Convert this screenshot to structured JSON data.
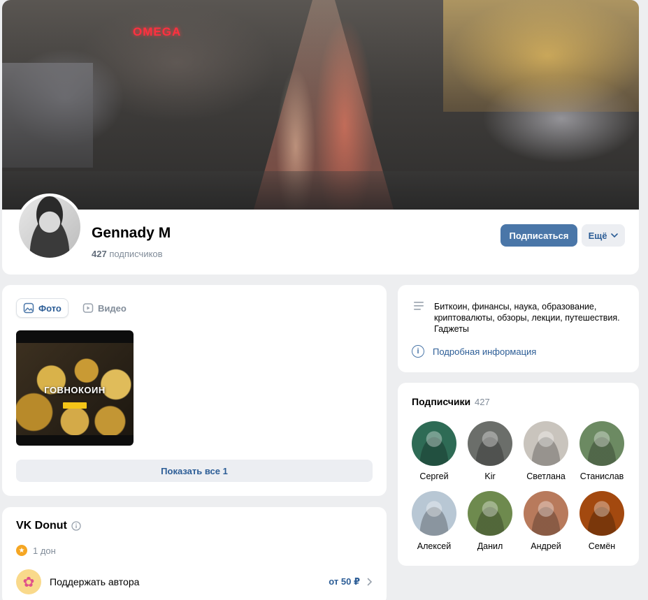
{
  "cover": {
    "sign_text": "OMEGA"
  },
  "profile": {
    "name": "Gennady M",
    "subscribers_count": "427",
    "subscribers_label": "подписчиков",
    "subscribe_button": "Подписаться",
    "more_button": "Ещё"
  },
  "media": {
    "tabs": [
      {
        "label": "Фото",
        "active": true
      },
      {
        "label": "Видео",
        "active": false
      }
    ],
    "thumb_title": "ГОВНОКОИН",
    "show_all": "Показать все 1"
  },
  "donut": {
    "title": "VK Donut",
    "count": "1 дон",
    "support_label": "Поддержать автора",
    "price": "от 50 ₽"
  },
  "info": {
    "description": "Биткоин, финансы, наука, образование, криптовалюты, обзоры, лекции, путешествия. Гаджеты",
    "more_link": "Подробная информация"
  },
  "subscribers": {
    "title": "Подписчики",
    "count": "427",
    "items": [
      {
        "name": "Сергей",
        "color": "#2e6b55"
      },
      {
        "name": "Kir",
        "color": "#6b6e6a"
      },
      {
        "name": "Светлана",
        "color": "#c9c4bd"
      },
      {
        "name": "Станислав",
        "color": "#6c8a62"
      },
      {
        "name": "Алексей",
        "color": "#b8c7d4"
      },
      {
        "name": "Данил",
        "color": "#6e8a4e"
      },
      {
        "name": "Андрей",
        "color": "#b87a5c"
      },
      {
        "name": "Семён",
        "color": "#a3490f"
      }
    ]
  }
}
